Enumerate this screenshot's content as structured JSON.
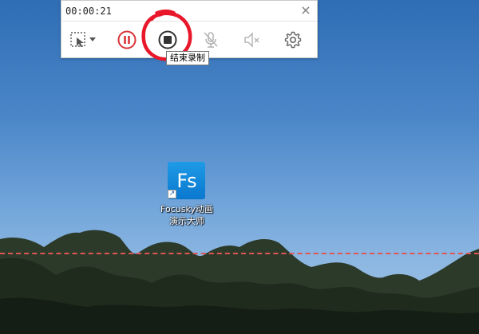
{
  "recorder": {
    "timer": "00:00:21",
    "close_symbol": "×",
    "tools": [
      {
        "name": "region-select-icon"
      },
      {
        "name": "dropdown-arrow-icon"
      },
      {
        "name": "pause-icon"
      },
      {
        "name": "stop-icon"
      },
      {
        "name": "microphone-muted-icon"
      },
      {
        "name": "speaker-muted-icon"
      },
      {
        "name": "gear-icon"
      }
    ],
    "tooltip": "结束录制",
    "colors": {
      "pause": "#d9343a",
      "stop": "#333333",
      "disabled": "#b5b5b5",
      "annotation": "#e8182a"
    }
  },
  "desktop": {
    "shortcut": {
      "tile_text": "Fs",
      "label_line1": "Focusky动画",
      "label_line2": "演示大师",
      "tile_color": "#0a78cf"
    },
    "dashed_line_color": "#e25555"
  }
}
